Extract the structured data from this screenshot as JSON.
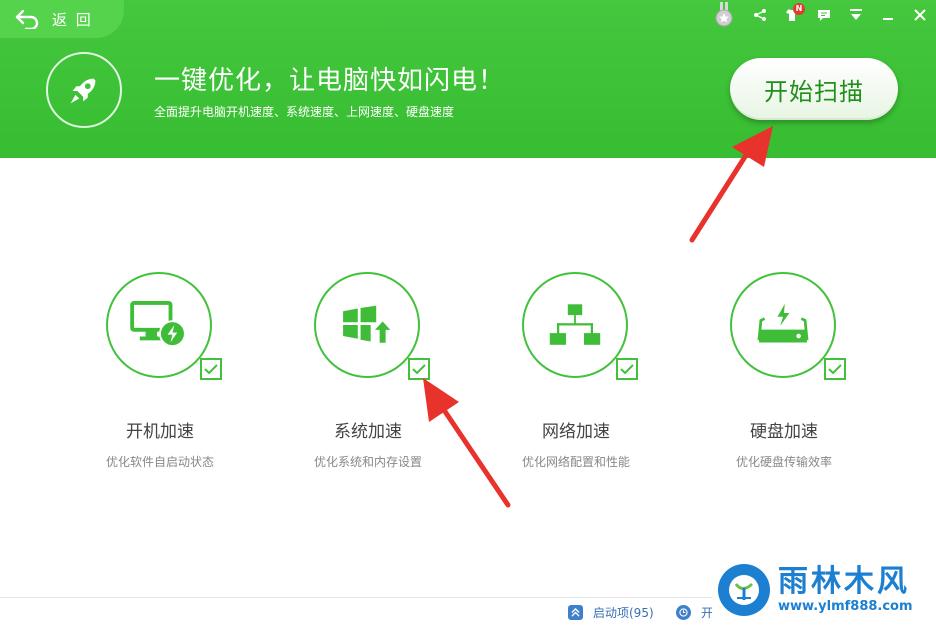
{
  "header": {
    "back_label": "返 回",
    "headline": "一键优化，让电脑快如闪电！",
    "subline": "全面提升电脑开机速度、系统速度、上网速度、硬盘速度",
    "scan_button_label": "开始扫描",
    "notification_badge": "N"
  },
  "cards": [
    {
      "title": "开机加速",
      "desc": "优化软件自启动状态",
      "icon": "monitor-bolt-icon",
      "checked": true
    },
    {
      "title": "系统加速",
      "desc": "优化系统和内存设置",
      "icon": "windows-up-icon",
      "checked": true
    },
    {
      "title": "网络加速",
      "desc": "优化网络配置和性能",
      "icon": "network-icon",
      "checked": true
    },
    {
      "title": "硬盘加速",
      "desc": "优化硬盘传输效率",
      "icon": "harddisk-bolt-icon",
      "checked": true
    }
  ],
  "footer": {
    "startup_items": "启动项(95)",
    "second_item": "开"
  },
  "watermark": {
    "brand": "雨林木风",
    "url": "www.ylmf888.com"
  },
  "colors": {
    "header_green": "#3fc238",
    "accent_green": "#44c13c",
    "arrow_red": "#e8322c",
    "link_blue": "#3a6fb0"
  }
}
